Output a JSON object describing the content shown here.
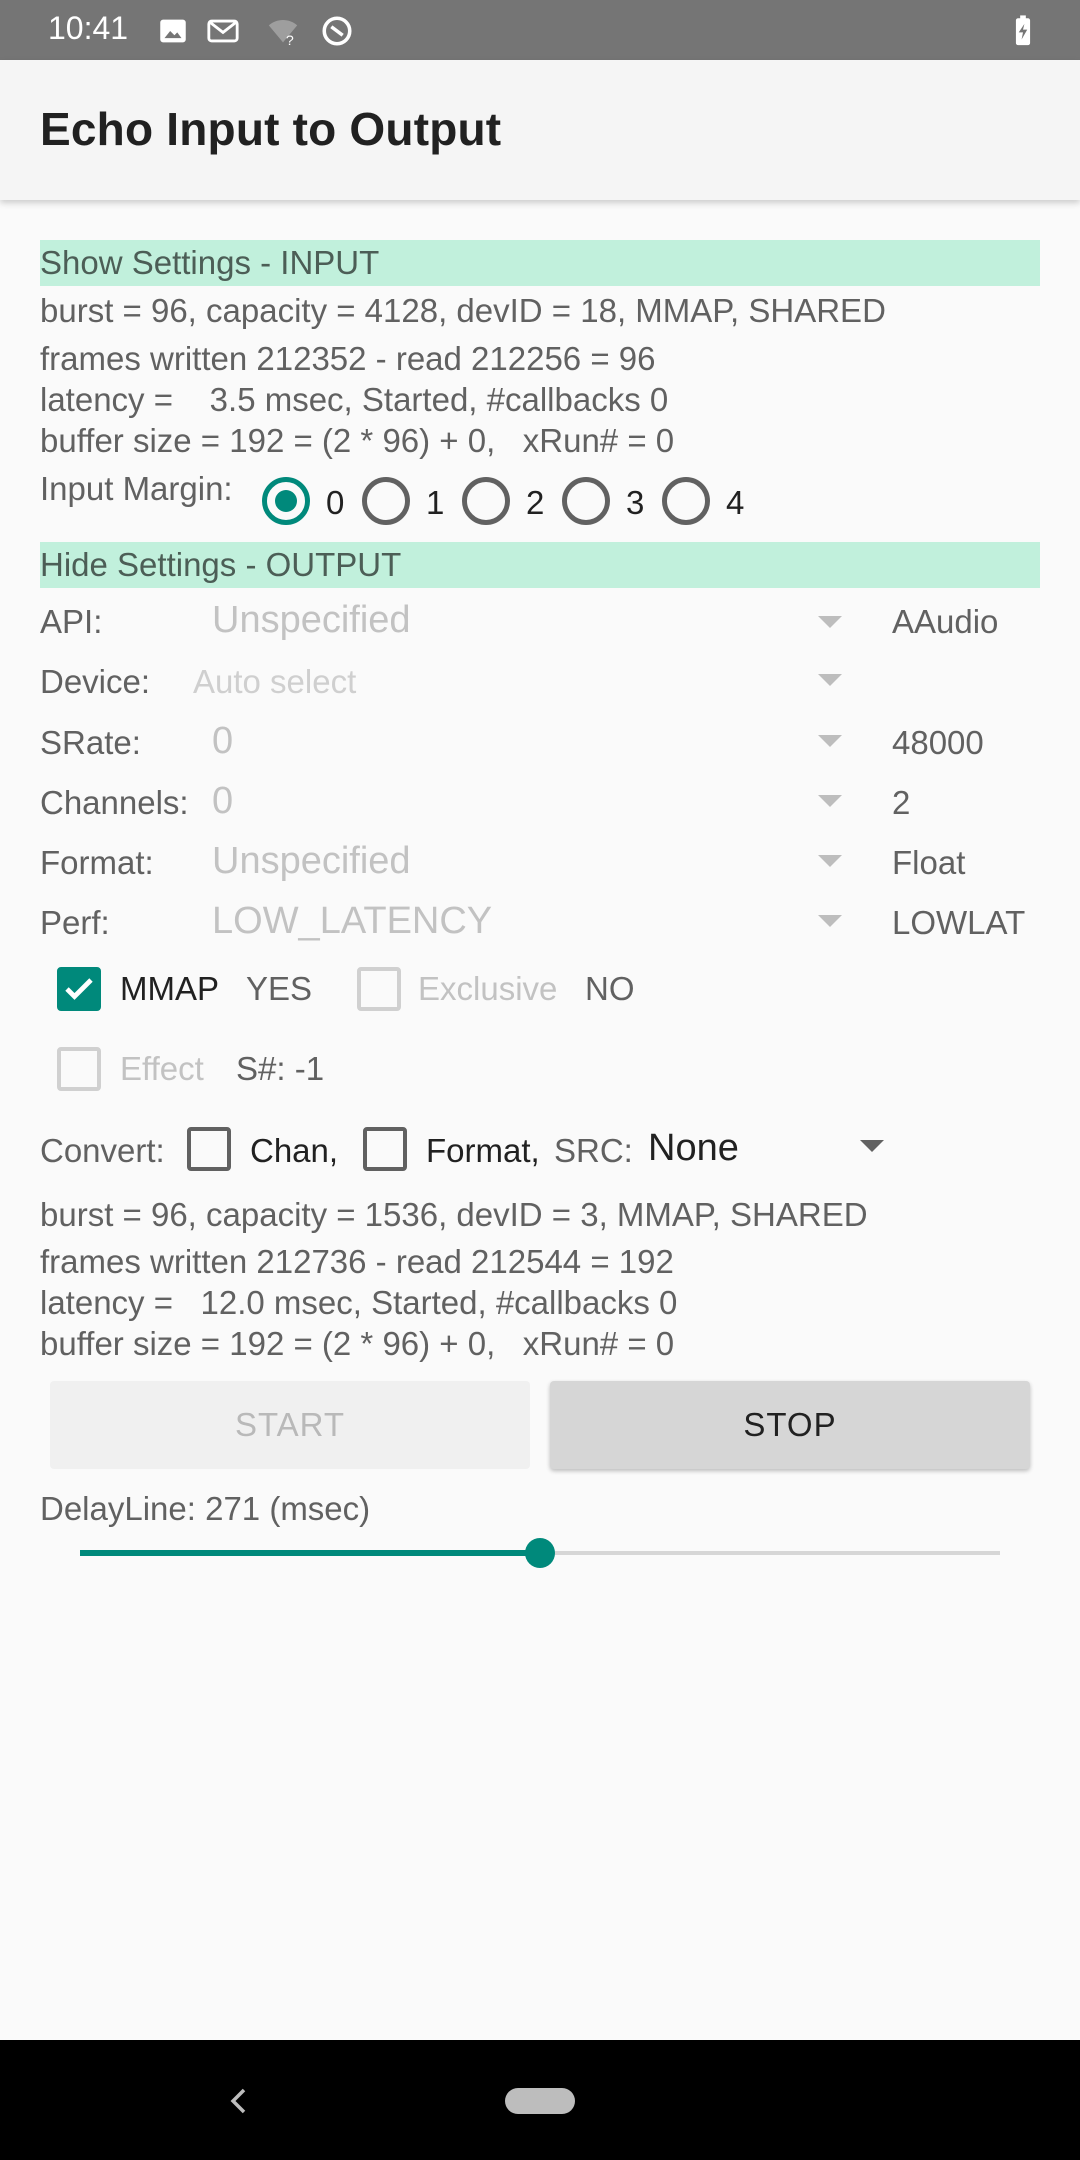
{
  "status_bar": {
    "time": "10:41",
    "icons": [
      "image-icon",
      "gmail-icon",
      "wifi-unknown-icon",
      "sync-icon"
    ],
    "battery_icon": "battery-charging-icon"
  },
  "app_bar": {
    "title": "Echo Input to Output"
  },
  "input_section": {
    "header": "Show Settings - INPUT",
    "lines": [
      "burst = 96, capacity = 4128, devID = 18, MMAP, SHARED",
      "frames written 212352 - read 212256 = 96",
      "latency =    3.5 msec, Started, #callbacks 0",
      "buffer size = 192 = (2 * 96) + 0,   xRun# = 0"
    ],
    "margin_label": "Input Margin:",
    "margin_options": [
      "0",
      "1",
      "2",
      "3",
      "4"
    ],
    "margin_selected": "0"
  },
  "output_section": {
    "header": "Hide Settings - OUTPUT",
    "rows": [
      {
        "label": "API:",
        "value": "Unspecified",
        "actual": "AAudio"
      },
      {
        "label": "Device:",
        "value": "Auto select",
        "actual": ""
      },
      {
        "label": "SRate:",
        "value": "0",
        "actual": "48000"
      },
      {
        "label": "Channels:",
        "value": "0",
        "actual": "2"
      },
      {
        "label": "Format:",
        "value": "Unspecified",
        "actual": "Float"
      },
      {
        "label": "Perf:",
        "value": "LOW_LATENCY",
        "actual": "LOWLAT"
      }
    ],
    "mmap": {
      "label": "MMAP",
      "checked": true,
      "result": "YES"
    },
    "exclusive": {
      "label": "Exclusive",
      "checked": false,
      "result": "NO"
    },
    "effect": {
      "label": "Effect",
      "checked": false,
      "session": "S#: -1"
    },
    "convert": {
      "label": "Convert:",
      "chan_label": "Chan,",
      "format_label": "Format,",
      "src_label": "SRC:",
      "src_value": "None"
    },
    "lines": [
      "burst = 96, capacity = 1536, devID = 3, MMAP, SHARED",
      "frames written 212736 - read 212544 = 192",
      "latency =   12.0 msec, Started, #callbacks 0",
      "buffer size = 192 = (2 * 96) + 0,   xRun# = 0"
    ]
  },
  "buttons": {
    "start": "START",
    "stop": "STOP"
  },
  "delay": {
    "label": "DelayLine: 271 (msec)",
    "slider_fraction": 0.5
  },
  "colors": {
    "accent": "#00897B",
    "header_bg": "#C1F0DC",
    "status_bar": "#757575"
  }
}
